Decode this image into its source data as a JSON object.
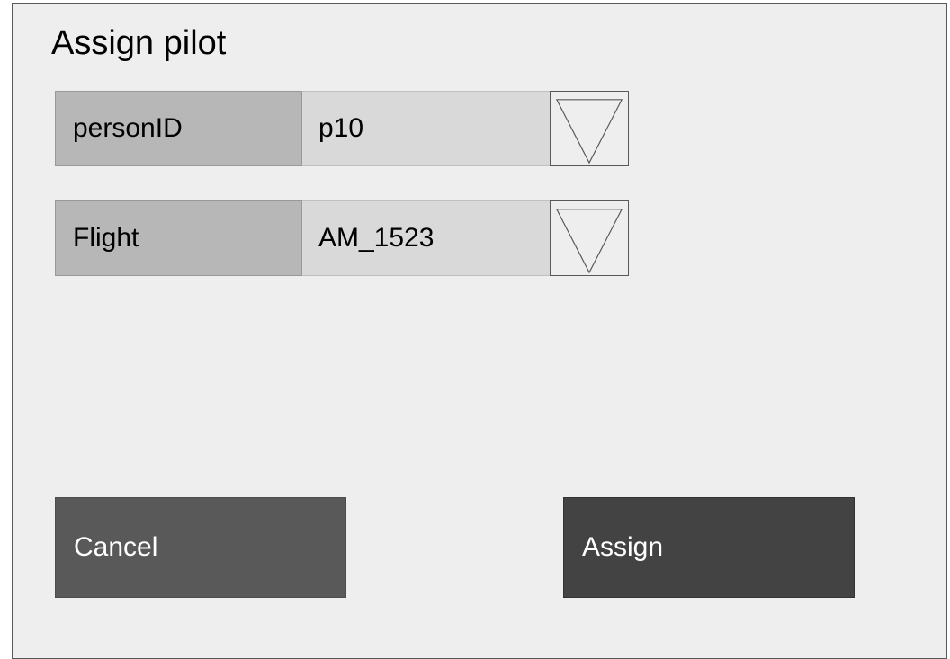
{
  "dialog": {
    "title": "Assign pilot"
  },
  "fields": [
    {
      "label": "personID",
      "value": "p10",
      "dropdown_icon": "triangle-down-icon"
    },
    {
      "label": "Flight",
      "value": "AM_1523",
      "dropdown_icon": "triangle-down-icon"
    }
  ],
  "buttons": {
    "cancel_label": "Cancel",
    "assign_label": "Assign"
  },
  "colors": {
    "background": "#eeeeee",
    "label_bg": "#b7b7b7",
    "value_bg": "#d9d9d9",
    "cancel_bg": "#595959",
    "assign_bg": "#434343"
  }
}
